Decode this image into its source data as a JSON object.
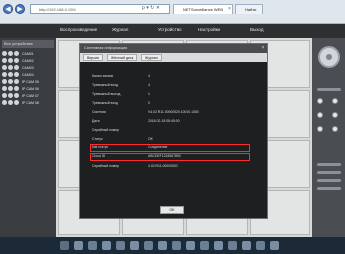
{
  "browser": {
    "back_glyph": "◀",
    "forward_glyph": "▶",
    "address": "http://192.168.0.100/",
    "address_icons": "ρ ▾ ↻ ✕",
    "tab1": "NETSurveillance WEB",
    "tab2": "Найти",
    "tab_close": "×"
  },
  "app_menu": [
    "Воспроизведение",
    "Журнал",
    "Устройство",
    "Настройки",
    "Выход"
  ],
  "left_panel": {
    "header": "Все устройства",
    "cameras": [
      "CAM01",
      "CAM02",
      "CAM03",
      "CAM04",
      "IP CAM 05",
      "IP CAM 06",
      "IP CAM 07",
      "IP CAM 08"
    ]
  },
  "dialog": {
    "title": "Системная информация",
    "close": "×",
    "tabs": [
      "Версия",
      "Жёсткий диск",
      "Журнал"
    ],
    "rows": [
      {
        "label": "Канал записи",
        "value": "4"
      },
      {
        "label": "Тревожный вход",
        "value": "4"
      },
      {
        "label": "Тревожный выход",
        "value": "1"
      },
      {
        "label": "Тревожный вход",
        "value": "0"
      },
      {
        "label": "Система",
        "value": "V4.02.R11.00000520.10010.1300"
      },
      {
        "label": "Дата",
        "value": "2016-02-18 08:45:00"
      },
      {
        "label": "Серийный номер",
        "value": ""
      },
      {
        "label": "Статус",
        "value": "OK"
      },
      {
        "label": "Nat статус",
        "value": "Соединение"
      },
      {
        "label": "Cloud ID",
        "value": "ABCDEF1234567890"
      },
      {
        "label": "Серийный номер",
        "value": "4.02.R11.00000520"
      }
    ],
    "ok": "OK"
  }
}
